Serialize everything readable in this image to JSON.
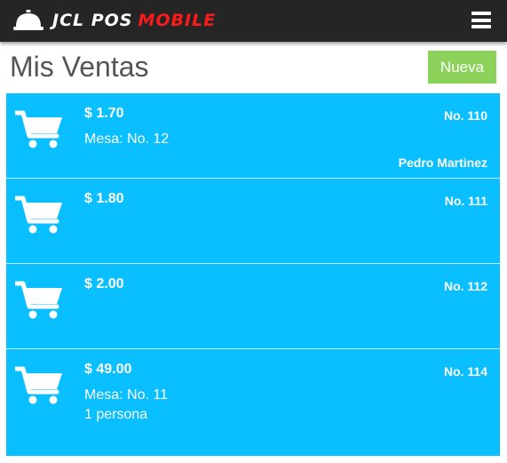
{
  "app": {
    "brand_primary": "JCL POS",
    "brand_accent": "MOBILE",
    "brand_accent_color": "#ff1a1a",
    "navbar_color": "#252525",
    "logo_icon": "service-bell-icon",
    "menu_icon": "hamburger-menu-icon"
  },
  "page": {
    "title": "Mis Ventas",
    "new_label": "Nueva",
    "new_button_color": "#8bd15a"
  },
  "sales": {
    "item_color": "#0abfff",
    "item_icon": "shopping-cart-icon",
    "items": [
      {
        "amount": "$ 1.70",
        "line1": "Mesa: No. 12",
        "line2": "",
        "number": "No. 110",
        "waiter": "Pedro Martinez"
      },
      {
        "amount": "$ 1.80",
        "line1": "",
        "line2": "",
        "number": "No. 111",
        "waiter": ""
      },
      {
        "amount": "$ 2.00",
        "line1": "",
        "line2": "",
        "number": "No. 112",
        "waiter": ""
      },
      {
        "amount": "$ 49.00",
        "line1": "Mesa: No. 11",
        "line2": "1 persona",
        "number": "No. 114",
        "waiter": ""
      }
    ]
  }
}
